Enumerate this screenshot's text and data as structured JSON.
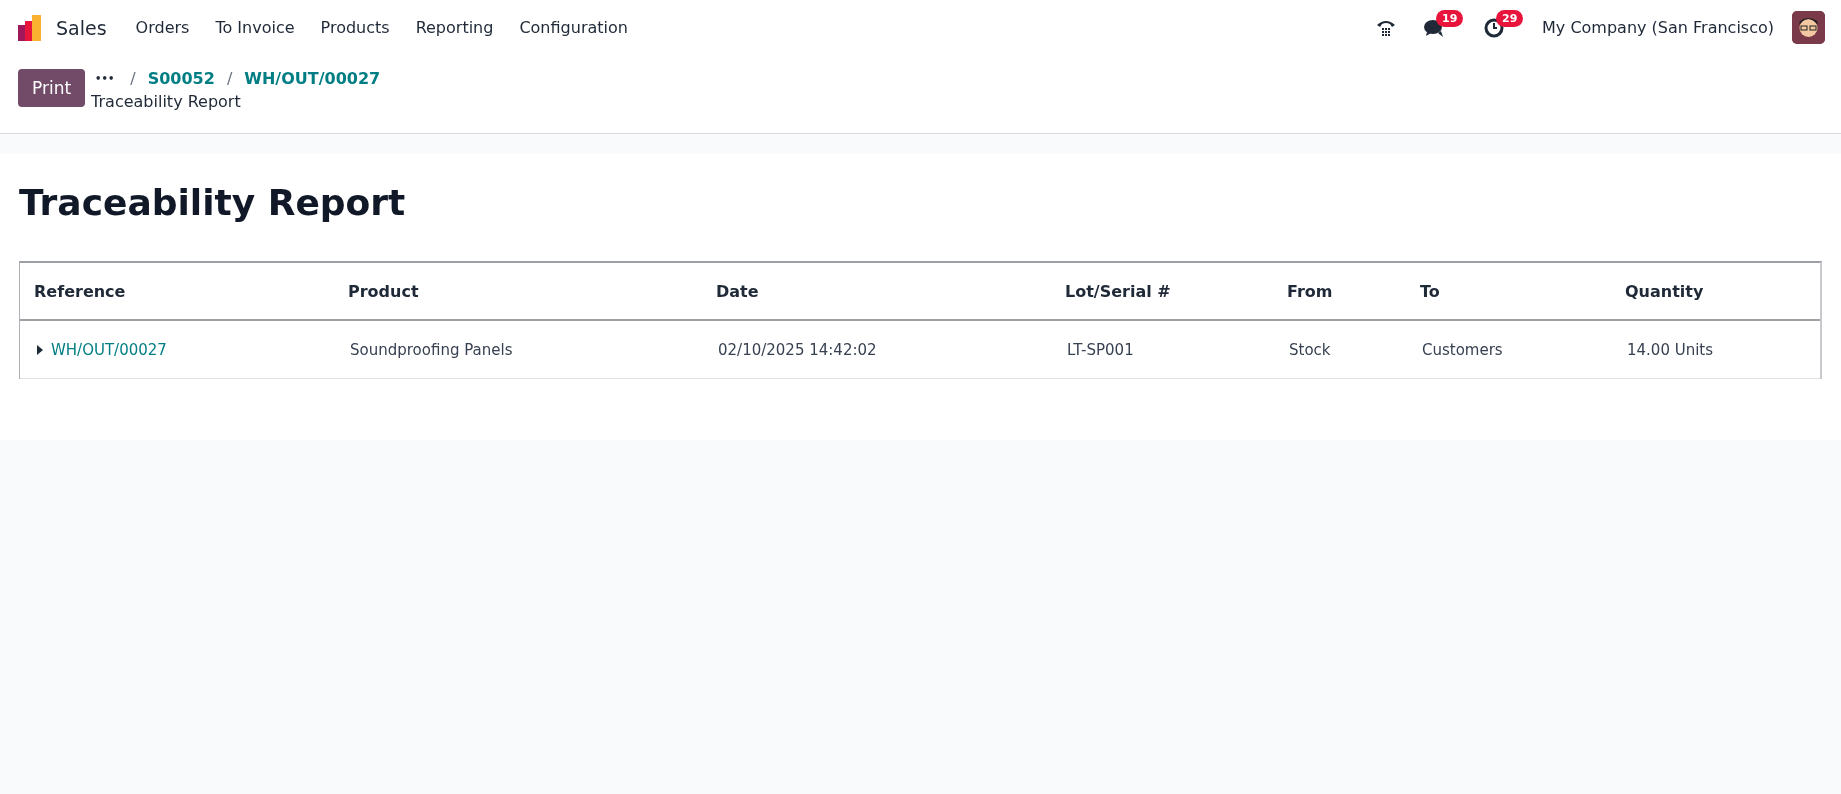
{
  "navbar": {
    "app_name": "Sales",
    "menu": [
      "Orders",
      "To Invoice",
      "Products",
      "Reporting",
      "Configuration"
    ],
    "messages_badge": "19",
    "activities_badge": "29",
    "company": "My Company (San Francisco)"
  },
  "control_panel": {
    "print_button": "Print",
    "breadcrumb_more": "•••",
    "breadcrumbs": [
      {
        "separator": "/",
        "label": "S00052"
      },
      {
        "separator": "/",
        "label": "WH/OUT/00027"
      }
    ],
    "current": "Traceability Report"
  },
  "report": {
    "title": "Traceability Report",
    "columns": [
      "Reference",
      "Product",
      "Date",
      "Lot/Serial #",
      "From",
      "To",
      "Quantity"
    ],
    "rows": [
      {
        "expanded": false,
        "cells": [
          "WH/OUT/00027",
          "Soundproofing Panels",
          "02/10/2025 14:42:02",
          "LT-SP001",
          "Stock",
          "Customers",
          "14.00 Units"
        ]
      }
    ]
  }
}
